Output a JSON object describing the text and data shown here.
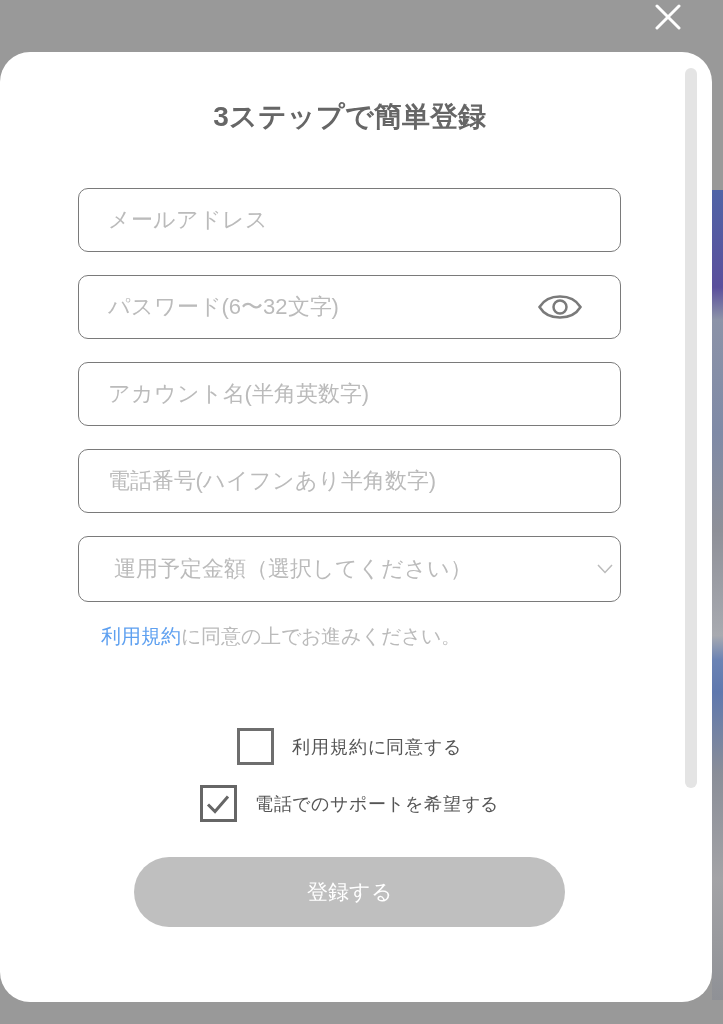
{
  "dialog": {
    "title": "3ステップで簡単登録",
    "fields": [
      {
        "kind": "text",
        "placeholder": "メールアドレス"
      },
      {
        "kind": "password",
        "placeholder": "パスワード(6〜32文字)"
      },
      {
        "kind": "text",
        "placeholder": "アカウント名(半角英数字)"
      },
      {
        "kind": "text",
        "placeholder": "電話番号(ハイフンあり半角数字)"
      },
      {
        "kind": "select",
        "placeholder": "運用予定金額（選択してください）"
      }
    ],
    "terms_note": {
      "link": "利用規約",
      "text": "に同意の上でお進みください。"
    },
    "checkboxes": [
      {
        "label": "利用規約に同意する",
        "checked": false
      },
      {
        "label": "電話でのサポートを希望する",
        "checked": true
      }
    ],
    "submit": {
      "label": "登録する",
      "disabled": true
    }
  }
}
